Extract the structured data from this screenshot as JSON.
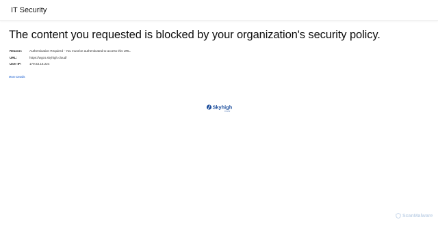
{
  "header": {
    "title": "IT Security"
  },
  "main": {
    "headline": "The content you requested is blocked by your organization's security policy.",
    "details": [
      {
        "label": "Reason:",
        "value": "Authentication Required - You must be authenticated to access this URL."
      },
      {
        "label": "URL:",
        "value": "https://wgcs.skyhigh.cloud/"
      },
      {
        "label": "User IP:",
        "value": "179.63.16.224"
      }
    ],
    "more_details_link": "More Details"
  },
  "logo": {
    "wordmark": "Skyhigh",
    "subtext": "security",
    "color": "#1b4d9c"
  },
  "watermark": {
    "text": "ScanMalware",
    "color": "#c3d4e8"
  }
}
